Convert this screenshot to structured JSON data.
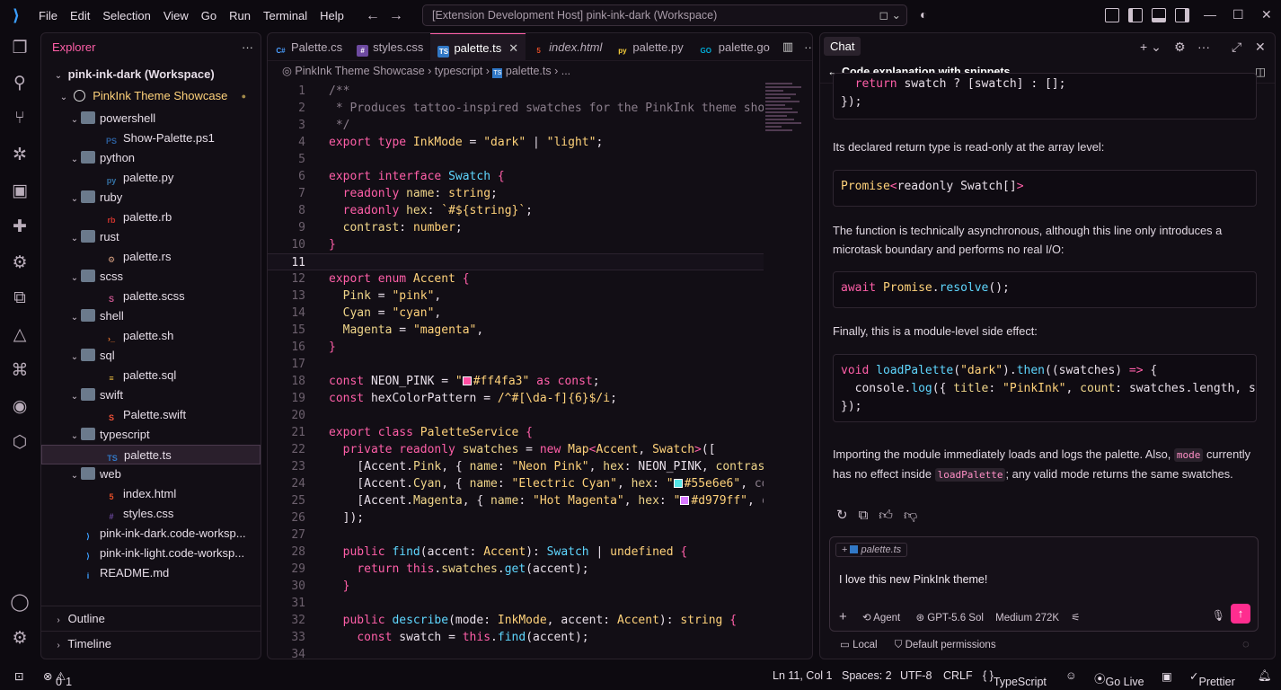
{
  "titlebar": {
    "menus": [
      "File",
      "Edit",
      "Selection",
      "View",
      "Go",
      "Run",
      "Terminal",
      "Help"
    ],
    "command_center": "[Extension Development Host] pink-ink-dark (Workspace)"
  },
  "explorer": {
    "title": "Explorer",
    "workspace": "pink-ink-dark (Workspace)",
    "root_folder": "PinkInk Theme Showcase",
    "tree": [
      {
        "label": "powershell",
        "type": "folder",
        "depth": 1
      },
      {
        "label": "Show-Palette.ps1",
        "type": "file",
        "depth": 2,
        "icon": "powershell-icon"
      },
      {
        "label": "python",
        "type": "folder",
        "depth": 1
      },
      {
        "label": "palette.py",
        "type": "file",
        "depth": 2,
        "icon": "python-icon"
      },
      {
        "label": "ruby",
        "type": "folder",
        "depth": 1
      },
      {
        "label": "palette.rb",
        "type": "file",
        "depth": 2,
        "icon": "ruby-icon"
      },
      {
        "label": "rust",
        "type": "folder",
        "depth": 1
      },
      {
        "label": "palette.rs",
        "type": "file",
        "depth": 2,
        "icon": "rust-icon"
      },
      {
        "label": "scss",
        "type": "folder",
        "depth": 1
      },
      {
        "label": "palette.scss",
        "type": "file",
        "depth": 2,
        "icon": "scss-icon"
      },
      {
        "label": "shell",
        "type": "folder",
        "depth": 1
      },
      {
        "label": "palette.sh",
        "type": "file",
        "depth": 2,
        "icon": "shell-icon"
      },
      {
        "label": "sql",
        "type": "folder",
        "depth": 1
      },
      {
        "label": "palette.sql",
        "type": "file",
        "depth": 2,
        "icon": "database-icon"
      },
      {
        "label": "swift",
        "type": "folder",
        "depth": 1
      },
      {
        "label": "Palette.swift",
        "type": "file",
        "depth": 2,
        "icon": "swift-icon"
      },
      {
        "label": "typescript",
        "type": "folder",
        "depth": 1
      },
      {
        "label": "palette.ts",
        "type": "file",
        "depth": 2,
        "icon": "typescript-icon",
        "selected": true
      },
      {
        "label": "web",
        "type": "folder",
        "depth": 1
      },
      {
        "label": "index.html",
        "type": "file",
        "depth": 2,
        "icon": "html-icon"
      },
      {
        "label": "styles.css",
        "type": "file",
        "depth": 2,
        "icon": "css-icon"
      },
      {
        "label": "pink-ink-dark.code-worksp...",
        "type": "file",
        "depth": 1,
        "icon": "vscode-icon"
      },
      {
        "label": "pink-ink-light.code-worksp...",
        "type": "file",
        "depth": 1,
        "icon": "vscode-icon"
      },
      {
        "label": "README.md",
        "type": "file",
        "depth": 1,
        "icon": "info-icon"
      }
    ],
    "outline": "Outline",
    "timeline": "Timeline"
  },
  "editor": {
    "tabs": [
      {
        "label": "Palette.cs",
        "icon": "C#"
      },
      {
        "label": "styles.css",
        "icon": "css"
      },
      {
        "label": "palette.ts",
        "icon": "TS",
        "active": true
      },
      {
        "label": "index.html",
        "icon": "5"
      },
      {
        "label": "palette.py",
        "icon": "py"
      },
      {
        "label": "palette.go",
        "icon": "GO"
      }
    ],
    "breadcrumb": [
      "PinkInk Theme Showcase",
      "typescript",
      "palette.ts",
      "..."
    ],
    "current_line": 11,
    "colors": {
      "neon_pink": "#ff4fa3",
      "electric_cyan": "#55e6e6",
      "hot_magenta": "#d979ff"
    }
  },
  "chat": {
    "tab": "Chat",
    "subtitle": "Code explanation with snippets",
    "code_top": "  return swatch ? [swatch] : [];\n});",
    "p1": "Its declared return type is read-only at the array level:",
    "code1": "Promise<readonly Swatch[]>",
    "p2": "The function is technically asynchronous, although this line only introduces a microtask boundary and performs no real I/O:",
    "code2": "await Promise.resolve();",
    "p3": "Finally, this is a module-level side effect:",
    "p4_a": "Importing the module immediately loads and logs the palette. Also,",
    "p4_code1": "mode",
    "p4_b": "currently has no effect inside",
    "p4_code2": "loadPalette",
    "p4_c": "; any valid mode returns the same swatches.",
    "input": {
      "attachment": "palette.ts",
      "text": "I love this new PinkInk theme!",
      "mode": "Agent",
      "model": "GPT-5.6 Sol",
      "effort": "Medium 272K"
    },
    "footer_left": "Local",
    "footer_perm": "Default permissions"
  },
  "statusbar": {
    "errors": "0",
    "warnings": "1",
    "position": "Ln 11, Col 1",
    "spaces": "Spaces: 2",
    "encoding": "UTF-8",
    "eol": "CRLF",
    "language": "TypeScript",
    "golive": "Go Live",
    "prettier": "Prettier"
  }
}
